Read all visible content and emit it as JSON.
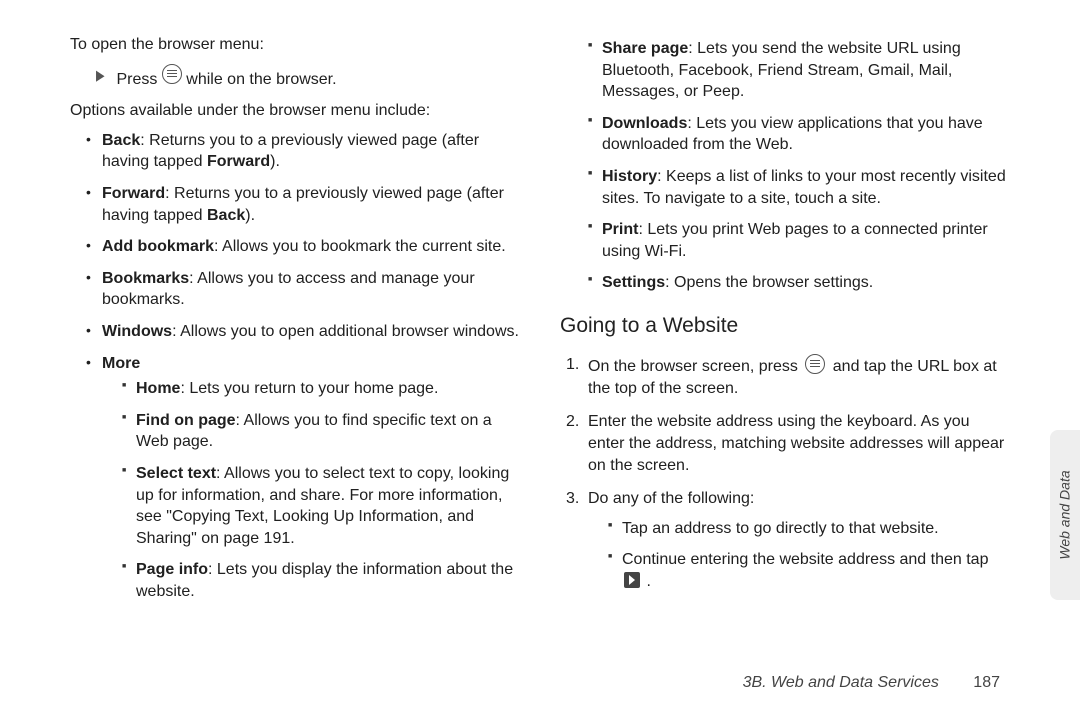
{
  "left": {
    "intro": "To open the browser menu:",
    "press_prefix": "Press ",
    "press_suffix": " while on the browser.",
    "options_line": "Options available under the browser menu include:",
    "items": {
      "back_label": "Back",
      "back_text_a": ": Returns you to a previously viewed page (after having tapped ",
      "back_text_b": "Forward",
      "back_text_c": ").",
      "forward_label": "Forward",
      "forward_text_a": ": Returns you to a previously viewed page (after having tapped ",
      "forward_text_b": "Back",
      "forward_text_c": ").",
      "addbm_label": "Add bookmark",
      "addbm_text": ": Allows you to bookmark the current site.",
      "bookmarks_label": "Bookmarks",
      "bookmarks_text": ": Allows you to access and manage your bookmarks.",
      "windows_label": "Windows",
      "windows_text": ": Allows you to open additional browser windows.",
      "more_label": "More",
      "home_label": "Home",
      "home_text": ": Lets you return to your home page.",
      "find_label": "Find on page",
      "find_text": ": Allows you to find specific text on a Web page.",
      "select_label": "Select text",
      "select_text": ": Allows you to select text to copy, looking up for information, and share. For more information, see \"Copying Text, Looking Up Information, and Sharing\" on page 191.",
      "pageinfo_label": "Page info",
      "pageinfo_text": ": Lets you display the information about the website."
    }
  },
  "right": {
    "items": {
      "share_label": "Share page",
      "share_text": ": Lets you send the website URL using Bluetooth, Facebook, Friend Stream, Gmail, Mail, Messages, or Peep.",
      "dl_label": "Downloads",
      "dl_text": ": Lets you view applications that you have downloaded from the Web.",
      "history_label": "History",
      "history_text": ": Keeps a list of links to your most recently visited sites. To navigate to a site, touch a site.",
      "print_label": "Print",
      "print_text": ": Lets you print Web pages to a connected printer using Wi-Fi.",
      "settings_label": "Settings",
      "settings_text": ": Opens the browser settings."
    },
    "heading": "Going to a Website",
    "steps": {
      "s1_num": "1.",
      "s1_a": "On the browser screen, press ",
      "s1_b": " and tap the URL box at the top of the screen.",
      "s2_num": "2.",
      "s2": "Enter the website address using the keyboard. As you enter the address, matching website addresses will appear on the screen.",
      "s3_num": "3.",
      "s3": "Do any of the following:",
      "s3a": "Tap an address to go directly to that website.",
      "s3b_a": "Continue entering the website address and then tap ",
      "s3b_b": "."
    }
  },
  "footer": {
    "section": "3B. Web and Data Services",
    "page": "187"
  },
  "side_tab": "Web and Data"
}
